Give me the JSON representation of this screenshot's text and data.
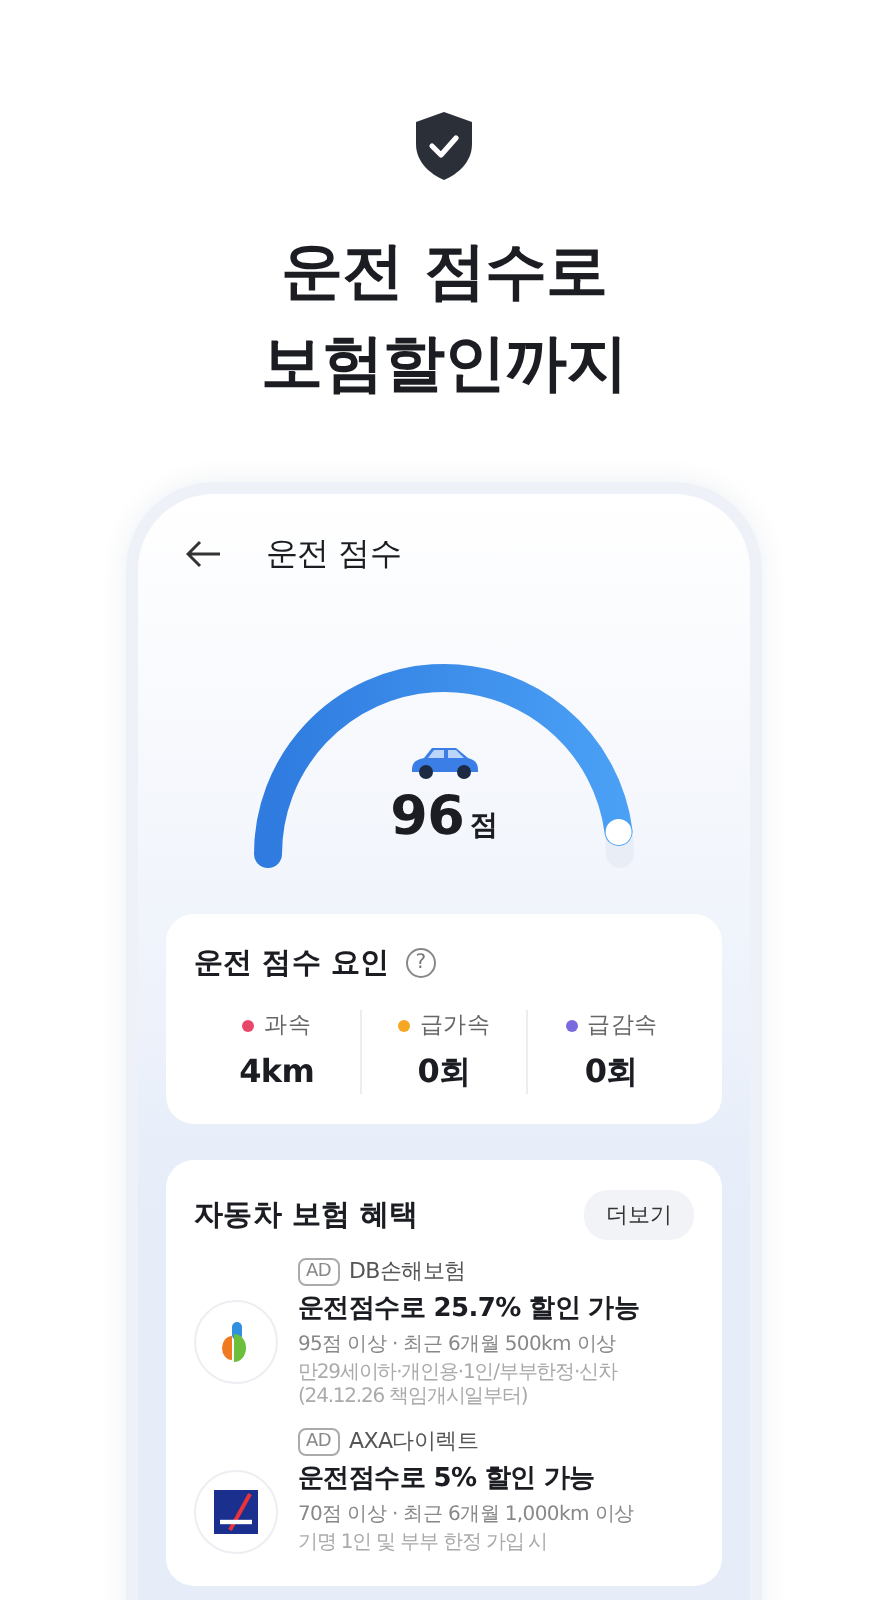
{
  "hero": {
    "title_lines": [
      "운전 점수로",
      "보험할인까지"
    ]
  },
  "screen": {
    "title": "운전 점수",
    "gauge": {
      "level": 0.96,
      "score": "96",
      "unit": "점"
    },
    "factors": {
      "title": "운전 점수 요인",
      "help": "?",
      "items": [
        {
          "label": "과속",
          "value": "4km",
          "color": "#e8476a"
        },
        {
          "label": "급가속",
          "value": "0회",
          "color": "#f5a623"
        },
        {
          "label": "급감속",
          "value": "0회",
          "color": "#7a6ae0"
        }
      ]
    },
    "benefits": {
      "title": "자동차 보험 혜택",
      "more": "더보기",
      "offers": [
        {
          "kind": "db",
          "ad": "AD",
          "company": "DB손해보험",
          "headline": "운전점수로 25.7% 할인 가능",
          "condition": "95점 이상 · 최근 6개월 500km 이상",
          "note": "만29세이하·개인용·1인/부부한정·신차(24.12.26 책임개시일부터)"
        },
        {
          "kind": "axa",
          "ad": "AD",
          "company": "AXA다이렉트",
          "headline": "운전점수로 5% 할인 가능",
          "condition": "70점 이상 · 최근 6개월 1,000km 이상",
          "note": "기명 1인 및 부부 한정 가입 시"
        }
      ]
    }
  }
}
